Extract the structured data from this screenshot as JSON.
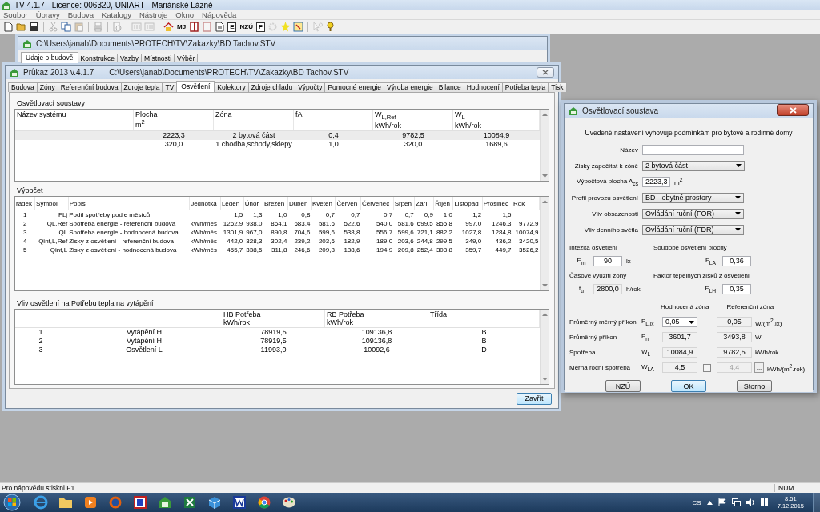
{
  "app": {
    "title": "TV 4.1.7 -  Licence: 006320,  UNIART - Mariánské Lázně",
    "menu": [
      "Soubor",
      "Úpravy",
      "Budova",
      "Katalogy",
      "Nástroje",
      "Okno",
      "Nápověda"
    ],
    "toolbar": [
      {
        "kind": "new",
        "disabled": false
      },
      {
        "kind": "open",
        "disabled": false
      },
      {
        "kind": "save",
        "disabled": false
      },
      {
        "kind": "separator"
      },
      {
        "kind": "cut",
        "disabled": true
      },
      {
        "kind": "copy",
        "disabled": false
      },
      {
        "kind": "paste",
        "disabled": true
      },
      {
        "kind": "separator"
      },
      {
        "kind": "print",
        "disabled": true
      },
      {
        "kind": "separator"
      },
      {
        "kind": "preview",
        "disabled": true
      },
      {
        "kind": "separator"
      },
      {
        "kind": "chip",
        "disabled": true
      },
      {
        "kind": "chip",
        "disabled": true
      },
      {
        "kind": "separator"
      },
      {
        "kind": "house",
        "disabled": false
      },
      {
        "kind": "text",
        "label": "MJ",
        "disabled": false
      },
      {
        "kind": "book",
        "disabled": false
      },
      {
        "kind": "book",
        "disabled": true
      },
      {
        "kind": "page",
        "disabled": false
      },
      {
        "kind": "letter",
        "label": "E",
        "disabled": false
      },
      {
        "kind": "text",
        "label": "NZÚ",
        "disabled": false
      },
      {
        "kind": "letter",
        "label": "P",
        "disabled": false
      },
      {
        "kind": "gear",
        "disabled": true
      },
      {
        "kind": "sun",
        "disabled": false
      },
      {
        "kind": "window",
        "disabled": false
      },
      {
        "kind": "separator"
      },
      {
        "kind": "whatsthis",
        "disabled": true
      },
      {
        "kind": "help",
        "disabled": false
      }
    ]
  },
  "back_window": {
    "title": "C:\\Users\\janab\\Documents\\PROTECH\\TV\\Zakazky\\BD Tachov.STV",
    "tabs": [
      {
        "label": "Údaje o budově",
        "selected": true
      },
      {
        "label": "Konstrukce",
        "selected": false
      },
      {
        "label": "Vazby",
        "selected": false
      },
      {
        "label": "Místnosti",
        "selected": false
      },
      {
        "label": "Výběr",
        "selected": false
      }
    ]
  },
  "main_window": {
    "name": "Průkaz 2013  v.4.1.7",
    "path": "C:\\Users\\janab\\Documents\\PROTECH\\TV\\Zakazky\\BD Tachov.STV",
    "tabs": [
      {
        "label": "Budova",
        "selected": false
      },
      {
        "label": "Zóny",
        "selected": false
      },
      {
        "label": "Referenční budova",
        "selected": false
      },
      {
        "label": "Zdroje tepla",
        "selected": false
      },
      {
        "label": "TV",
        "selected": false
      },
      {
        "label": "Osvětlení",
        "selected": true
      },
      {
        "label": "Kolektory",
        "selected": false
      },
      {
        "label": "Zdroje chladu",
        "selected": false
      },
      {
        "label": "Výpočty",
        "selected": false
      },
      {
        "label": "Pomocné energie",
        "selected": false
      },
      {
        "label": "Výroba energie",
        "selected": false
      },
      {
        "label": "Bilance",
        "selected": false
      },
      {
        "label": "Hodnocení",
        "selected": false
      },
      {
        "label": "Potřeba tepla",
        "selected": false
      },
      {
        "label": "Tisk",
        "selected": false
      }
    ],
    "systems": {
      "title": "Osvětlovací soustavy",
      "columns": [
        {
          "label": "Název systému"
        },
        {
          "label": "Plocha",
          "unit": "m$^{2}$"
        },
        {
          "label": "Zóna"
        },
        {
          "label": "fA"
        },
        {
          "label": "W$_{L,Ref}$",
          "unit": "kWh/rok"
        },
        {
          "label": "W$_{L}$",
          "unit": "kWh/rok"
        }
      ],
      "rows": [
        {
          "area": "2223,3",
          "zone": "2 bytová část",
          "fa": "0,4",
          "wl_ref": "9782,5",
          "wl": "10084,9",
          "selected": true
        },
        {
          "area": "320,0",
          "zone": "1 chodba,schody,sklepy",
          "fa": "1,0",
          "wl_ref": "320,0",
          "wl": "1689,6",
          "selected": false
        }
      ]
    },
    "calculation": {
      "title": "Výpočet",
      "columns": [
        "řádek",
        "Symbol",
        "Popis",
        "Jednotka",
        "Leden",
        "Únor",
        "Březen",
        "Duben",
        "Květen",
        "Červen",
        "Červenec",
        "Srpen",
        "Září",
        "Říjen",
        "Listopad",
        "Prosinec",
        "Rok"
      ],
      "rows": [
        {
          "row": "1",
          "symbol": "FLj",
          "description": "Podíl spotřeby podle měsíců",
          "values": [
            "1,5",
            "1,3",
            "1,0",
            "0,8",
            "0,7",
            "0,7",
            "0,7",
            "0,7",
            "0,9",
            "1,0",
            "1,2",
            "1,5"
          ]
        },
        {
          "row": "2",
          "symbol": "QL,Ref",
          "description": "Spotřeba energie - referenční budova",
          "unit": "kWh/měs",
          "values": [
            "1262,9",
            "938,0",
            "864,1",
            "683,4",
            "581,6",
            "522,6",
            "540,0",
            "581,6",
            "699,5",
            "855,8",
            "997,0",
            "1246,3"
          ],
          "total": "9772,9"
        },
        {
          "row": "3",
          "symbol": "QL",
          "description": "Spotřeba energie - hodnocená budova",
          "unit": "kWh/měs",
          "values": [
            "1301,9",
            "967,0",
            "890,8",
            "704,6",
            "599,6",
            "538,8",
            "556,7",
            "599,6",
            "721,1",
            "882,2",
            "1027,8",
            "1284,8"
          ],
          "total": "10074,9"
        },
        {
          "row": "4",
          "symbol": "Qint,L,Ref",
          "description": "Zisky z osvětlení - referenční budova",
          "unit": "kWh/měs",
          "values": [
            "442,0",
            "328,3",
            "302,4",
            "239,2",
            "203,6",
            "182,9",
            "189,0",
            "203,6",
            "244,8",
            "299,5",
            "349,0",
            "436,2"
          ],
          "total": "3420,5"
        },
        {
          "row": "5",
          "symbol": "Qint,L",
          "description": "Zisky z osvětlení - hodnocená budova",
          "unit": "kWh/měs",
          "values": [
            "455,7",
            "338,5",
            "311,8",
            "246,6",
            "209,8",
            "188,6",
            "194,9",
            "209,8",
            "252,4",
            "308,8",
            "359,7",
            "449,7"
          ],
          "total": "3526,2"
        }
      ]
    },
    "heating": {
      "title": "Vliv osvětlení na Potřebu tepla na vytápění",
      "columns": [
        {
          "label": "HB Potřeba",
          "unit": "kWh/rok"
        },
        {
          "label": "RB Potřeba",
          "unit": "kWh/rok"
        },
        {
          "label": "Třída"
        }
      ],
      "rows": [
        {
          "column_1": "1",
          "column_2": "Vytápění H",
          "hb": "78919,5",
          "rb": "109136,8",
          "class": "B"
        },
        {
          "column_1": "2",
          "column_2": "Vytápění H",
          "hb": "78919,5",
          "rb": "109136,8",
          "class": "B"
        },
        {
          "column_1": "3",
          "column_2": "Osvětlení L",
          "hb": "11993,0",
          "rb": "10092,6",
          "class": "D"
        }
      ]
    },
    "close_button": "Zavřít"
  },
  "dialog": {
    "title": "Osvětlovací soustava",
    "note": "Uvedené nastavení vyhovuje podmínkám pro bytové a rodinné domy",
    "name_label": "Název",
    "zone": {
      "label": "Zisky započítat k zóně",
      "value": "2 bytová část"
    },
    "area": {
      "label": "Výpočtová plocha A$_{cs}$",
      "value": "2223,3",
      "unit": "m$^{2}$"
    },
    "selects": [
      {
        "label": "Profil provozu osvětlení",
        "value": "BD - obytné prostory"
      },
      {
        "label": "Vliv obsazenosti",
        "value": "Ovládání ruční (FOR)"
      },
      {
        "label": "Vliv denního světla",
        "value": "Ovládání ruční (FDR)"
      }
    ],
    "params": [
      {
        "heading": "Intezita osvětlení",
        "symbol": "E$_{m}$",
        "value": "90",
        "unit": "lx",
        "kind": "input"
      },
      {
        "heading": "Soudobé osvětlení plochy",
        "symbol": "F$_{LA}$",
        "value": "0,36",
        "kind": "input"
      },
      {
        "heading": "Časové využití zóny",
        "symbol": "t$_{u}$",
        "value": "2800,0",
        "unit": "h/rok",
        "kind": "readonly"
      },
      {
        "heading": "Faktor tepelných zisků z osvětlení",
        "symbol": "F$_{LH}$",
        "value": "0,35",
        "kind": "input"
      }
    ],
    "columns": [
      "Hodnocená zóna",
      "Referenční zóna"
    ],
    "results": [
      {
        "label": "Průměrný měrný příkon",
        "symbol": "P$_{L,lx}$",
        "rated": {
          "value": "0,05",
          "kind": "dropdown"
        },
        "reference": {
          "value": "0,05",
          "kind": "readonly"
        },
        "unit": "W/(m$^{2}$.lx)"
      },
      {
        "label": "Průměrný příkon",
        "symbol": "P$_{n}$",
        "rated": {
          "value": "3601,7",
          "kind": "readonly"
        },
        "reference": {
          "value": "3493,8",
          "kind": "readonly"
        },
        "unit": "W"
      },
      {
        "label": "Spotřeba",
        "symbol": "W$_{L}$",
        "rated": {
          "value": "10084,9",
          "kind": "readonly"
        },
        "reference": {
          "value": "9782,5",
          "kind": "readonly"
        },
        "unit": "kWh/rok"
      },
      {
        "label": "Měrná roční spotřeba",
        "symbol": "W$_{LA}$",
        "rated": {
          "value": "4,5",
          "kind": "readonly"
        },
        "reference": {
          "value": "4,4",
          "kind": "disabled"
        },
        "override": {
          "checked": false
        },
        "browse": "...",
        "unit": "kWh/(m$^{2}$.rok)"
      }
    ],
    "buttons": [
      {
        "label": "NZÚ",
        "default": false
      },
      {
        "label": "OK",
        "default": true
      },
      {
        "label": "Storno",
        "default": false
      }
    ]
  },
  "status_bar": {
    "hint": "Pro nápovědu stiskni  F1",
    "num": "NUM"
  },
  "taskbar": {
    "apps": [
      {
        "kind": "ie"
      },
      {
        "kind": "folder"
      },
      {
        "kind": "media"
      },
      {
        "kind": "firefox"
      },
      {
        "kind": "redapp"
      },
      {
        "kind": "tv"
      },
      {
        "kind": "excel"
      },
      {
        "kind": "cube"
      },
      {
        "kind": "word"
      },
      {
        "kind": "chrome"
      },
      {
        "kind": "paint"
      }
    ],
    "language": "CS",
    "time": "8:51",
    "date": "7.12.2015"
  }
}
